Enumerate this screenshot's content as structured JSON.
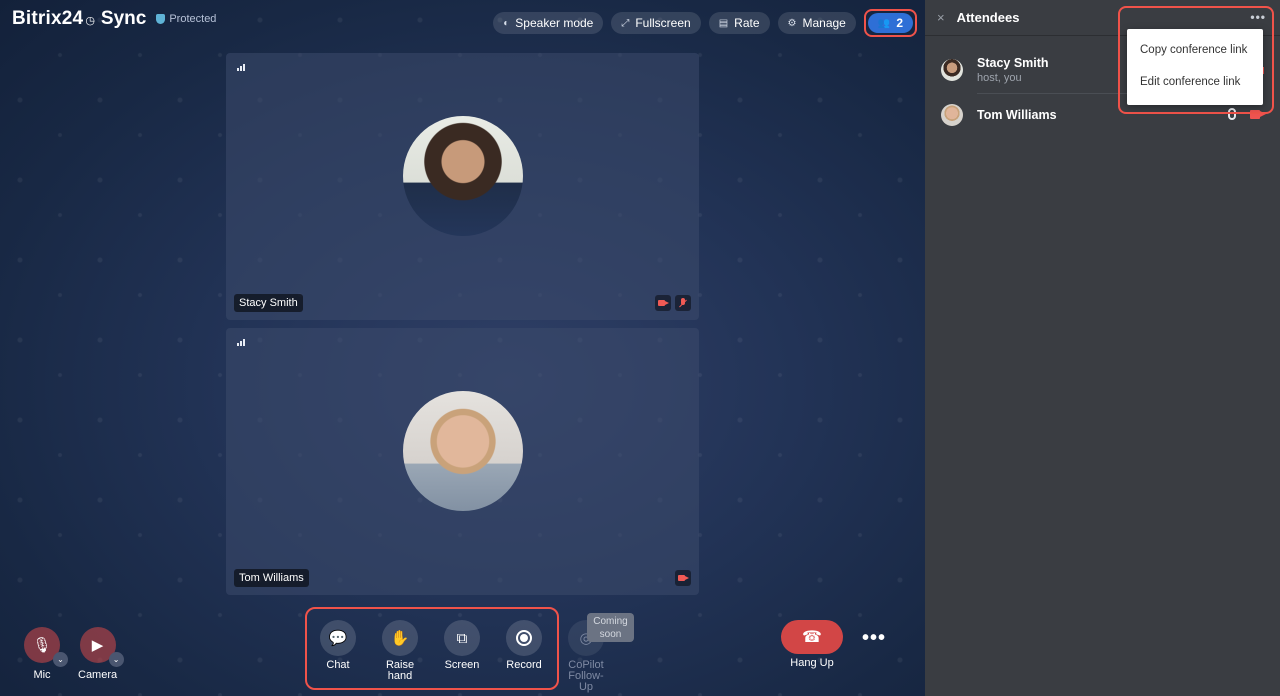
{
  "brand": {
    "name": "Bitrix24",
    "clock": "◷",
    "product": "Sync",
    "protected": "Protected"
  },
  "toolbar": {
    "speaker_mode": "Speaker mode",
    "fullscreen": "Fullscreen",
    "rate": "Rate",
    "manage": "Manage",
    "users_count": "2"
  },
  "tiles": [
    {
      "name": "Stacy Smith",
      "camera_off": true,
      "mic_off": true
    },
    {
      "name": "Tom Williams",
      "camera_off": true,
      "mic_off": false
    }
  ],
  "controls": {
    "mic": "Mic",
    "camera": "Camera",
    "chat": "Chat",
    "raise_hand": "Raise hand",
    "screen": "Screen",
    "record": "Record",
    "copilot": "CoPilot Follow-Up",
    "coming_soon": "Coming soon",
    "hang_up": "Hang Up",
    "more": "•••"
  },
  "sidebar": {
    "close": "×",
    "title": "Attendees",
    "more": "•••",
    "attendees": [
      {
        "name": "Stacy Smith",
        "role": "host, you"
      },
      {
        "name": "Tom Williams",
        "role": ""
      }
    ],
    "menu": [
      "Copy conference link",
      "Edit conference link"
    ]
  },
  "colors": {
    "accent": "#2e6fd6",
    "highlight": "#f0534a",
    "hangup": "#d24646",
    "sidebar_bg": "#3a3d42"
  }
}
